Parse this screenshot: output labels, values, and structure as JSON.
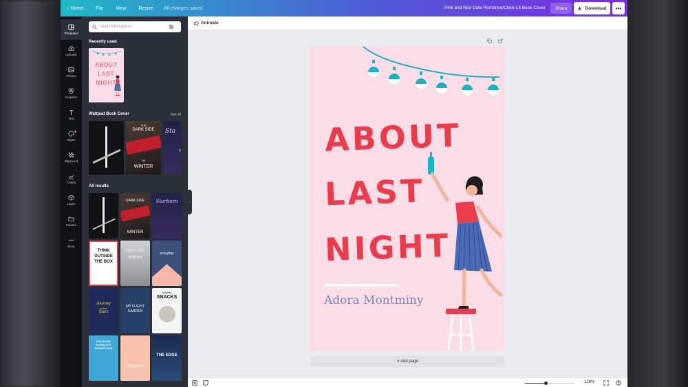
{
  "topbar": {
    "home_label": "Home",
    "file_label": "File",
    "view_label": "View",
    "resize_label": "Resize",
    "saved_status": "All changes saved",
    "doc_title": "Pink and Red Cute Romance/Chick Lit Book Cover",
    "share_label": "Share",
    "download_label": "Download",
    "more_label": "•••"
  },
  "rail": {
    "items": [
      {
        "label": "Templates",
        "icon": "layout-icon"
      },
      {
        "label": "Uploads",
        "icon": "cloud-upload-icon"
      },
      {
        "label": "Photos",
        "icon": "image-icon"
      },
      {
        "label": "Graphics",
        "icon": "shapes-icon"
      },
      {
        "label": "Text",
        "icon": "text-icon"
      },
      {
        "label": "Styles",
        "icon": "palette-icon"
      },
      {
        "label": "Bkground",
        "icon": "pattern-icon"
      },
      {
        "label": "Charts",
        "icon": "chart-icon"
      },
      {
        "label": "Logos",
        "icon": "cube-icon"
      },
      {
        "label": "Folders",
        "icon": "folder-icon"
      },
      {
        "label": "More",
        "icon": "dots-icon"
      }
    ]
  },
  "panel": {
    "search_placeholder": "Search templates",
    "recently_used_title": "Recently used",
    "wattpad_title": "Wattpad Book Cover",
    "see_all_label": "See all",
    "all_results_title": "All results",
    "recent_thumb_text": [
      "ABOUT",
      "LAST",
      "NIGHT"
    ],
    "thumbs": {
      "dark_side_a": "THE",
      "dark_side_b": "DARK SIDE",
      "dark_side_c": "OF",
      "dark_side_d": "WINTER",
      "think": [
        "THINK",
        "OUTSIDE",
        "THE BOX"
      ],
      "journey": [
        "Journey",
        "to the",
        "Stars"
      ],
      "garden": [
        "MY FLIGHT",
        "GARDEN"
      ],
      "snacks_a": "Healthy",
      "snacks_b": "SNACKS",
      "cultivate": [
        "CULTIVATE",
        "A HEALTHY",
        "WORKPLACE"
      ],
      "magnolia": "magnolia",
      "edge": "THE EDGE",
      "starborn": "Starborn",
      "everyday": "everyday"
    }
  },
  "subbar": {
    "animate_label": "Animate"
  },
  "cover": {
    "title_lines": [
      "ABOUT",
      "LAST",
      "NIGHT"
    ],
    "author": "Adora Montminy",
    "colors": {
      "background": "#fbdde8",
      "title": "#ea3c4a",
      "author": "#6e88c7",
      "bulb": "#1ab3c4"
    }
  },
  "canvas": {
    "add_page_label": "+ Add page"
  },
  "bottombar": {
    "zoom_level": "128%",
    "zoom_fraction": 0.42
  }
}
